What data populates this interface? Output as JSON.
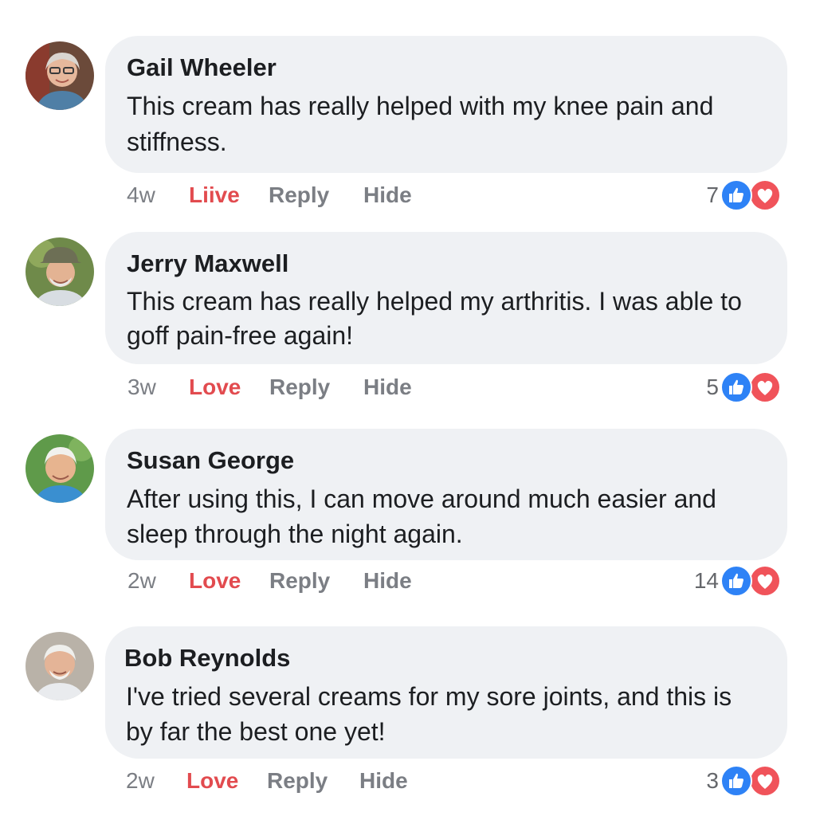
{
  "colors": {
    "bubble": "#eff1f4",
    "love": "#e24b4f",
    "like_icon": "#2e82f6",
    "heart_icon": "#f0535a",
    "muted": "#7b7e84"
  },
  "comments": [
    {
      "name": "Gail Wheeler",
      "text": "This cream has really helped with my knee pain and stiffness.",
      "time": "4w",
      "love_label": "Liive",
      "reply_label": "Reply",
      "hide_label": "Hide",
      "reaction_count": "7",
      "icons": [
        "avatar",
        "like-icon",
        "heart-icon"
      ]
    },
    {
      "name": "Jerry Maxwell",
      "text": "This cream has really helped my arthritis. I was able to goff pain-free again!",
      "time": "3w",
      "love_label": "Love",
      "reply_label": "Reply",
      "hide_label": "Hide",
      "reaction_count": "5",
      "icons": [
        "avatar",
        "like-icon",
        "heart-icon"
      ]
    },
    {
      "name": "Susan George",
      "text": "After using this, I can move around much easier and sleep through the night again.",
      "time": "2w",
      "love_label": "Love",
      "reply_label": "Reply",
      "hide_label": "Hide",
      "reaction_count": "14",
      "icons": [
        "avatar",
        "like-icon",
        "heart-icon"
      ]
    },
    {
      "name": "Bob Reynolds",
      "text": "I've tried several creams for my sore joints, and this is by far the best one yet!",
      "time": "2w",
      "love_label": "Love",
      "reply_label": "Reply",
      "hide_label": "Hide",
      "reaction_count": "3",
      "icons": [
        "avatar",
        "like-icon",
        "heart-icon"
      ]
    }
  ]
}
